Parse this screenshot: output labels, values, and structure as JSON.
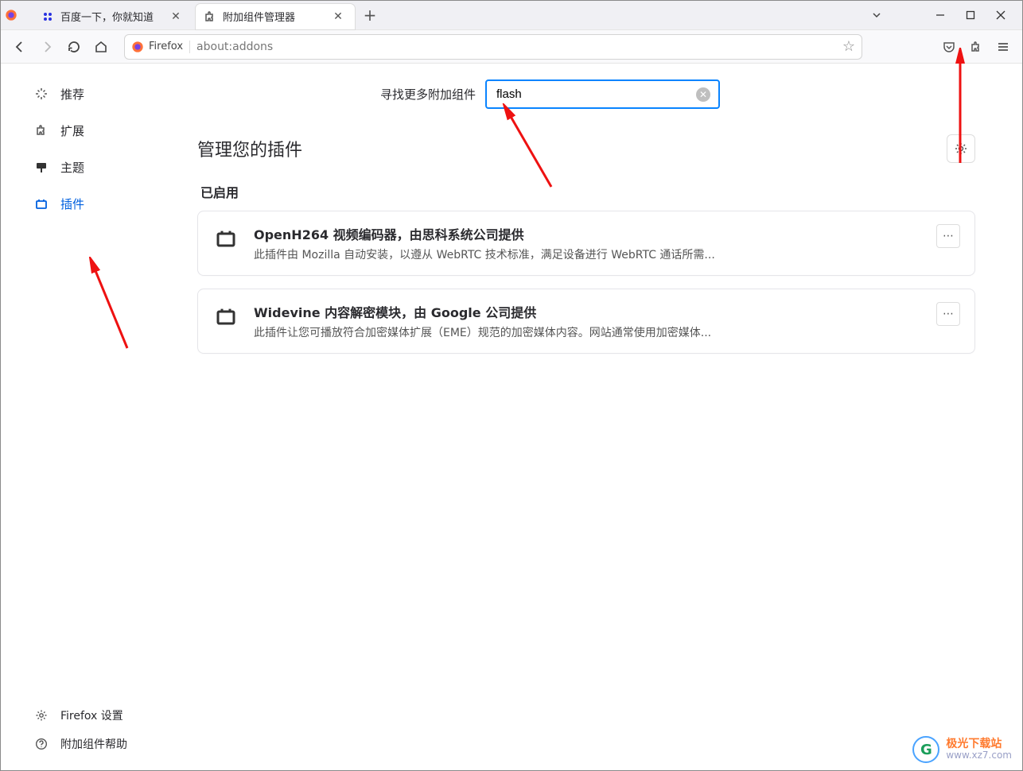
{
  "browser": {
    "tabs": [
      {
        "title": "百度一下，你就知道",
        "favicon": "🐾"
      },
      {
        "title": "附加组件管理器",
        "favicon": "puzzle"
      }
    ],
    "url_prefix": "Firefox",
    "url": "about:addons"
  },
  "sidebar": {
    "items": [
      {
        "id": "recommend",
        "label": "推荐",
        "icon": "sparkle"
      },
      {
        "id": "extensions",
        "label": "扩展",
        "icon": "puzzle"
      },
      {
        "id": "themes",
        "label": "主题",
        "icon": "paint"
      },
      {
        "id": "plugins",
        "label": "插件",
        "icon": "plugin"
      }
    ],
    "footer": [
      {
        "id": "settings",
        "label": "Firefox 设置",
        "icon": "gear"
      },
      {
        "id": "help",
        "label": "附加组件帮助",
        "icon": "question"
      }
    ]
  },
  "main": {
    "search": {
      "label": "寻找更多附加组件",
      "value": "flash"
    },
    "heading": "管理您的插件",
    "section_enabled": "已启用",
    "plugins": [
      {
        "name": "OpenH264 视频编码器，由思科系统公司提供",
        "desc": "此插件由 Mozilla 自动安装，以遵从 WebRTC 技术标准，满足设备进行 WebRTC 通话所需..."
      },
      {
        "name": "Widevine 内容解密模块，由 Google 公司提供",
        "desc": "此插件让您可播放符合加密媒体扩展（EME）规范的加密媒体内容。网站通常使用加密媒体..."
      }
    ]
  },
  "watermark": {
    "brand": "极光下载站",
    "url": "www.xz7.com"
  }
}
